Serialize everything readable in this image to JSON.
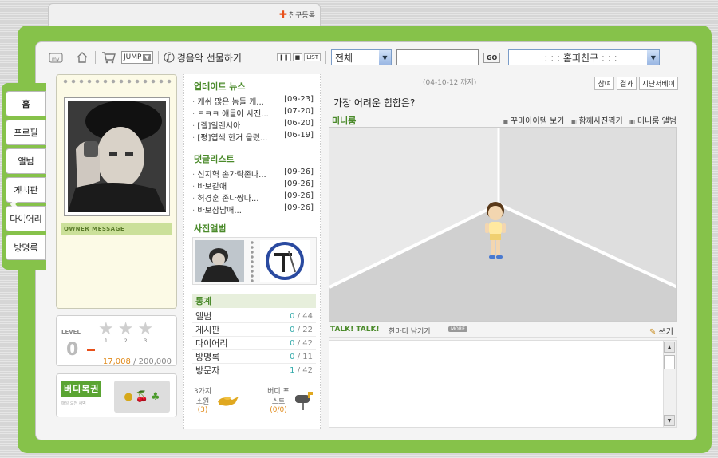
{
  "top": {
    "friend_register": "친구등록"
  },
  "toolbar": {
    "my_label": "my",
    "jump_label": "JUMP",
    "music_label": "경음악 선물하기",
    "list_label": "LIST",
    "category_select": "전체",
    "search_value": "",
    "go_label": "GO",
    "friends_select": ": : : 홈피친구 : : :"
  },
  "tabs": [
    "홈",
    "프로필",
    "앨범",
    "게시판",
    "다이어리",
    "방명록"
  ],
  "owner": {
    "message_label": "OWNER MESSAGE"
  },
  "level": {
    "label": "LEVEL",
    "value": "0",
    "star_nums": [
      "1",
      "2",
      "3"
    ],
    "points_current": "17,008",
    "points_total": " / 200,000"
  },
  "buddy": {
    "title": "버디복권",
    "subtitle": "매일 오전 새벽"
  },
  "news": {
    "title": "업데이트 뉴스",
    "items": [
      {
        "text": "캐쉬 많은 놈들 캐...",
        "date": "[09-23]"
      },
      {
        "text": "ㅋㅋㅋ 얘들아 사진...",
        "date": "[07-20]"
      },
      {
        "text": "[겔]일랜시아",
        "date": "[06-20]"
      },
      {
        "text": "[평]엽색 한거 올렸...",
        "date": "[06-19]"
      }
    ]
  },
  "comments": {
    "title": "댓글리스트",
    "items": [
      {
        "text": "신지혁 손가락존나...",
        "date": "[09-26]"
      },
      {
        "text": "바보같애",
        "date": "[09-26]"
      },
      {
        "text": "허경훈 존나짱나...",
        "date": "[09-26]"
      },
      {
        "text": "바보삼남매...",
        "date": "[09-26]"
      }
    ]
  },
  "album": {
    "title": "사진앨범"
  },
  "stats": {
    "title": "통계",
    "rows": [
      {
        "label": "앨범",
        "new": "0",
        "total": " / 44"
      },
      {
        "label": "게시판",
        "new": "0",
        "total": " / 22"
      },
      {
        "label": "다이어리",
        "new": "0",
        "total": " / 42"
      },
      {
        "label": "방명록",
        "new": "0",
        "total": " / 11"
      },
      {
        "label": "방문자",
        "new": "1",
        "total": " / 42"
      }
    ]
  },
  "bottom_mid": {
    "wish_label": "3가지 소원",
    "wish_count": "(3)",
    "post_label": "버디 포스트",
    "post_count": "(0/0)"
  },
  "poll": {
    "date_range": "(04-10-12 까지)",
    "btn_vote": "참여",
    "btn_result": "결과",
    "btn_past": "지난서베이",
    "question": "가장 어려운 힙합은?"
  },
  "miniroom": {
    "title": "미니룸",
    "link_items": "꾸미아이템 보기",
    "link_photo": "함께사진찍기",
    "link_album": "미니룸 앨범"
  },
  "talk": {
    "title": "TALK! TALK!",
    "subtitle": "한마디 남기기",
    "more": "MORE",
    "write": "쓰기"
  }
}
